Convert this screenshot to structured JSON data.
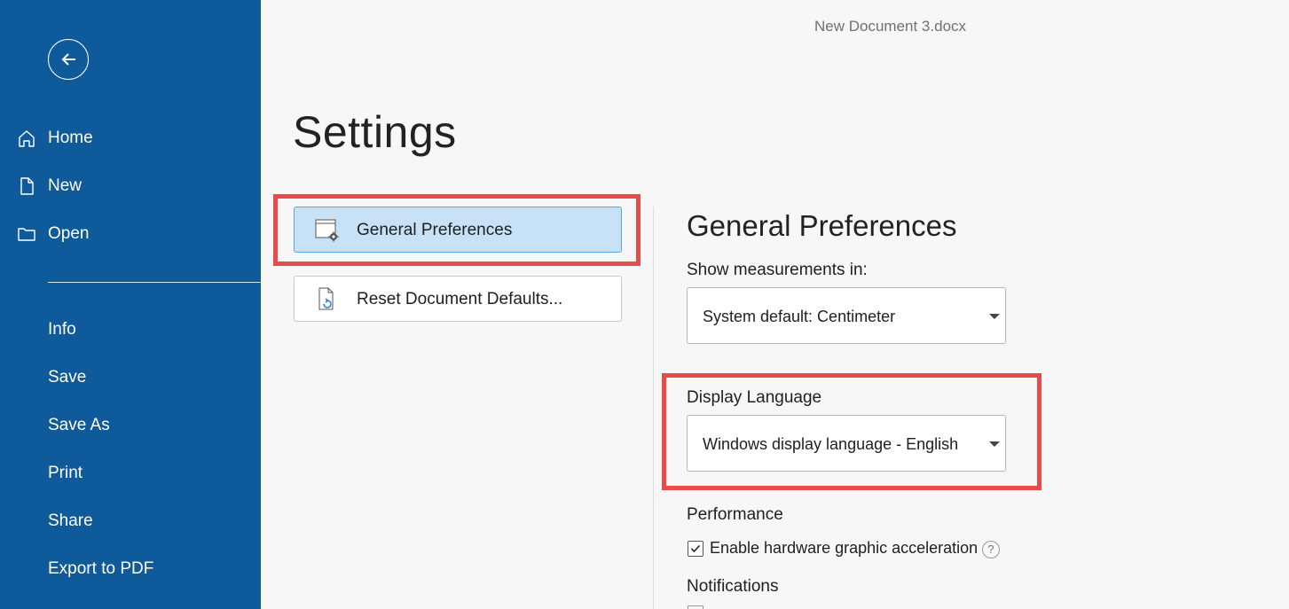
{
  "window": {
    "document_title": "New Document 3.docx"
  },
  "sidebar": {
    "back_icon": "arrow-left-icon",
    "items": [
      {
        "label": "Home",
        "icon": "home-icon"
      },
      {
        "label": "New",
        "icon": "document-icon"
      },
      {
        "label": "Open",
        "icon": "folder-icon"
      },
      {
        "label": "Info"
      },
      {
        "label": "Save"
      },
      {
        "label": "Save As"
      },
      {
        "label": "Print"
      },
      {
        "label": "Share"
      },
      {
        "label": "Export to PDF"
      }
    ],
    "background_color": "#0e5a9a"
  },
  "page": {
    "title": "Settings"
  },
  "settings_list": [
    {
      "label": "General Preferences",
      "icon": "window-gear-icon",
      "selected": true
    },
    {
      "label": "Reset Document Defaults...",
      "icon": "document-refresh-icon",
      "selected": false
    }
  ],
  "general_preferences": {
    "title": "General Preferences",
    "measurements": {
      "label": "Show measurements in:",
      "value": "System default: Centimeter"
    },
    "display_language": {
      "label": "Display Language",
      "value": "Windows display language - English"
    },
    "performance": {
      "label": "Performance",
      "hardware_acceleration": {
        "label": "Enable hardware graphic acceleration",
        "checked": true,
        "help": "?"
      }
    },
    "notifications": {
      "label": "Notifications"
    }
  },
  "colors": {
    "accent": "#0e5a9a",
    "selected_bg": "#c7e2f7",
    "highlight": "#e84b4b"
  }
}
